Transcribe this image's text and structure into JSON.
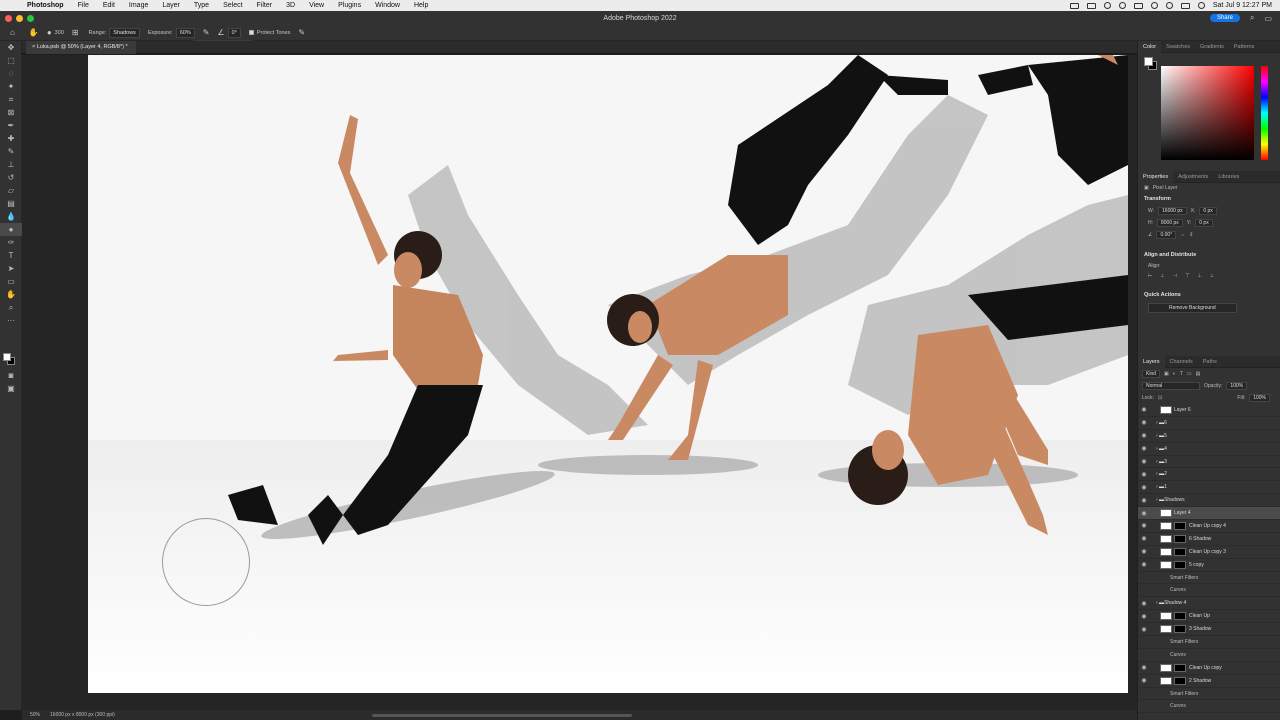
{
  "menubar": {
    "items": [
      "Photoshop",
      "File",
      "Edit",
      "Image",
      "Layer",
      "Type",
      "Select",
      "Filter",
      "3D",
      "View",
      "Plugins",
      "Window",
      "Help"
    ],
    "clock": "Sat Jul 9  12:27 PM"
  },
  "window": {
    "title": "Adobe Photoshop 2022",
    "share_label": "Share"
  },
  "options": {
    "brush_size": "300",
    "range_label": "Range:",
    "range_value": "Shadows",
    "exposure_label": "Exposure:",
    "exposure_value": "60%",
    "angle_value": "0°",
    "protect_label": "Protect Tones",
    "exposure_level": 0.6
  },
  "document": {
    "tab_title": "Luka.psb @ 50% (Layer 4, RGB/8*) *"
  },
  "status": {
    "zoom": "50%",
    "doc_size": "16000 px x 8000 px (300 ppi)"
  },
  "color_panel": {
    "tabs": [
      "Color",
      "Swatches",
      "Gradients",
      "Patterns"
    ],
    "foreground": "#ffffff",
    "background": "#000000"
  },
  "properties": {
    "tabs": [
      "Properties",
      "Adjustments",
      "Libraries"
    ],
    "kind": "Pixel Layer",
    "transform_label": "Transform",
    "w": "16000 px",
    "x": "0 px",
    "h": "8000 px",
    "y": "0 px",
    "angle": "0.00°",
    "align_label": "Align and Distribute",
    "align_sub": "Align:",
    "quick_label": "Quick Actions",
    "remove_bg": "Remove Background"
  },
  "layers_panel": {
    "tabs": [
      "Layers",
      "Channels",
      "Paths"
    ],
    "filter": "Kind",
    "blend": "Normal",
    "opacity_label": "Opacity:",
    "opacity": "100%",
    "lock_label": "Lock:",
    "fill_label": "Fill:",
    "fill": "100%",
    "layers": [
      {
        "name": "Layer 6",
        "type": "layer"
      },
      {
        "name": "6",
        "type": "group"
      },
      {
        "name": "5",
        "type": "group"
      },
      {
        "name": "4",
        "type": "group"
      },
      {
        "name": "3",
        "type": "group"
      },
      {
        "name": "2",
        "type": "group"
      },
      {
        "name": "1",
        "type": "group"
      },
      {
        "name": "Shadows",
        "type": "group"
      },
      {
        "name": "Layer 4",
        "type": "layer",
        "selected": true
      },
      {
        "name": "Clean Up copy 4",
        "type": "adjust"
      },
      {
        "name": "6 Shadow",
        "type": "smart"
      },
      {
        "name": "Clean Up copy 3",
        "type": "adjust"
      },
      {
        "name": "5 copy",
        "type": "smart"
      },
      {
        "name": "Smart Filters",
        "type": "sub"
      },
      {
        "name": "Curves",
        "type": "sub"
      },
      {
        "name": "Shadow 4",
        "type": "group"
      },
      {
        "name": "Clean Up",
        "type": "adjust"
      },
      {
        "name": "3 Shadow",
        "type": "smart"
      },
      {
        "name": "Smart Filters",
        "type": "sub"
      },
      {
        "name": "Curves",
        "type": "sub"
      },
      {
        "name": "Clean Up copy",
        "type": "adjust"
      },
      {
        "name": "2 Shadow",
        "type": "smart"
      },
      {
        "name": "Smart Filters",
        "type": "sub"
      },
      {
        "name": "Curves",
        "type": "sub"
      }
    ]
  }
}
